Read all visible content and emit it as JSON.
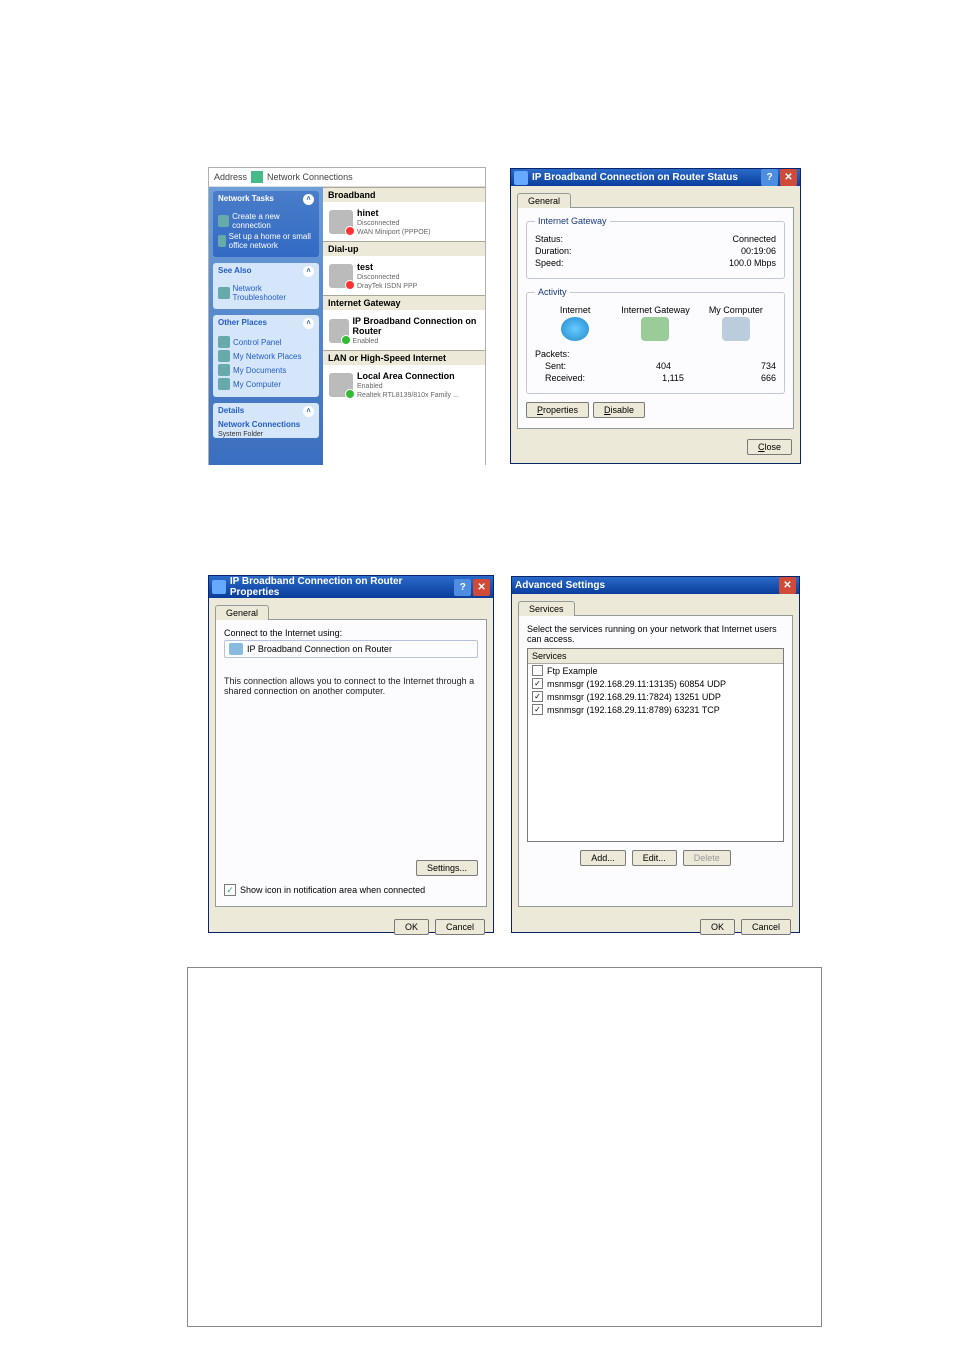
{
  "nc": {
    "address_label": "Address",
    "address_value": "Network Connections",
    "side": {
      "tasks": {
        "title": "Network Tasks",
        "items": [
          {
            "label": "Create a new connection"
          },
          {
            "label": "Set up a home or small office network"
          }
        ]
      },
      "seealso": {
        "title": "See Also",
        "items": [
          {
            "label": "Network Troubleshooter"
          }
        ]
      },
      "other": {
        "title": "Other Places",
        "items": [
          {
            "label": "Control Panel"
          },
          {
            "label": "My Network Places"
          },
          {
            "label": "My Documents"
          },
          {
            "label": "My Computer"
          }
        ]
      },
      "details": {
        "title": "Details",
        "name": "Network Connections",
        "type": "System Folder"
      }
    },
    "groups": {
      "broadband": {
        "header": "Broadband",
        "item": {
          "name": "hinet",
          "status": "Disconnected",
          "device": "WAN Miniport (PPPOE)"
        }
      },
      "dialup": {
        "header": "Dial-up",
        "item": {
          "name": "test",
          "status": "Disconnected",
          "device": "DrayTek ISDN PPP"
        }
      },
      "gateway": {
        "header": "Internet Gateway",
        "item": {
          "name": "IP Broadband Connection on Router",
          "status": "Enabled",
          "device": ""
        }
      },
      "lan": {
        "header": "LAN or High-Speed Internet",
        "item": {
          "name": "Local Area Connection",
          "status": "Enabled",
          "device": "Realtek RTL8139/810x Family ..."
        }
      }
    }
  },
  "status": {
    "title": "IP Broadband Connection on Router Status",
    "tab": "General",
    "gateway": {
      "legend": "Internet Gateway",
      "status_label": "Status:",
      "status_value": "Connected",
      "duration_label": "Duration:",
      "duration_value": "00:19:06",
      "speed_label": "Speed:",
      "speed_value": "100.0 Mbps"
    },
    "activity": {
      "legend": "Activity",
      "col1": "Internet",
      "col2": "Internet Gateway",
      "col3": "My Computer",
      "packets_label": "Packets:",
      "sent_label": "Sent:",
      "sent_gw": "404",
      "sent_pc": "734",
      "recv_label": "Received:",
      "recv_gw": "1,115",
      "recv_pc": "666"
    },
    "buttons": {
      "properties": "Properties",
      "disable": "Disable",
      "close": "Close"
    }
  },
  "props": {
    "title": "IP Broadband Connection on Router Properties",
    "tab": "General",
    "connect_label": "Connect to the Internet using:",
    "connect_value": "IP Broadband Connection on Router",
    "desc": "This connection allows you to connect to the Internet through a shared connection on another computer.",
    "settings_btn": "Settings...",
    "show_icon_label": "Show icon in notification area when connected",
    "show_icon_checked": true,
    "ok": "OK",
    "cancel": "Cancel"
  },
  "adv": {
    "title": "Advanced Settings",
    "tab": "Services",
    "desc": "Select the services running on your network that Internet users can access.",
    "list_header": "Services",
    "services": [
      {
        "checked": false,
        "label": "Ftp Example"
      },
      {
        "checked": true,
        "label": "msnmsgr (192.168.29.11:13135) 60854 UDP"
      },
      {
        "checked": true,
        "label": "msnmsgr (192.168.29.11:7824) 13251 UDP"
      },
      {
        "checked": true,
        "label": "msnmsgr (192.168.29.11:8789) 63231 TCP"
      }
    ],
    "buttons": {
      "add": "Add...",
      "edit": "Edit...",
      "delete": "Delete"
    },
    "ok": "OK",
    "cancel": "Cancel"
  }
}
